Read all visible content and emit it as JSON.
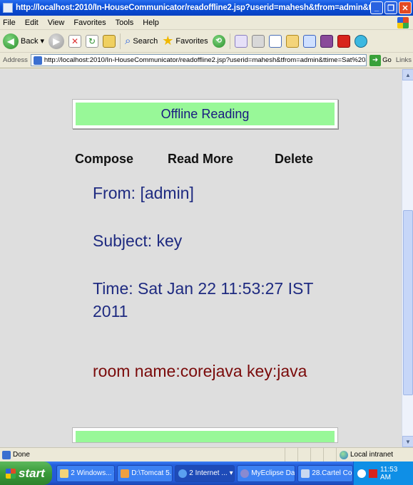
{
  "window": {
    "title": "http://localhost:2010/In-HouseCommunicator/readoffline2.jsp?userid=mahesh&tfrom=admin&ttime=Sat - Micro..."
  },
  "menu": [
    "File",
    "Edit",
    "View",
    "Favorites",
    "Tools",
    "Help"
  ],
  "toolbar": {
    "back": "Back",
    "search": "Search",
    "favorites": "Favorites"
  },
  "address": {
    "label": "Address",
    "url": "http://localhost:2010/In-HouseCommunicator/readoffline2.jsp?userid=mahesh&tfrom=admin&ttime=Sat%20Jan%2022%20",
    "go": "Go",
    "links": "Links"
  },
  "page": {
    "header": "Offline Reading",
    "nav": {
      "compose": "Compose",
      "read_more": "Read More",
      "delete": "Delete"
    },
    "message": {
      "from": "From: [admin]",
      "subject": "Subject: key",
      "time_line1": "Time: Sat Jan 22 11:53:27 IST",
      "time_line2": "2011",
      "body": "room name:corejava key:java"
    }
  },
  "status": {
    "text": "Done",
    "zone": "Local intranet"
  },
  "taskbar": {
    "start": "start",
    "tasks": [
      "2 Windows...",
      "D:\\Tomcat 5...",
      "2 Internet ...",
      "MyEclipse Da...",
      "28.Cartel Co..."
    ],
    "clock": "11:53 AM"
  },
  "colors": {
    "header_bg": "#98f898",
    "message_text": "#1e2a80",
    "body_text": "#7a0a0a",
    "content_bg": "#dedede"
  }
}
